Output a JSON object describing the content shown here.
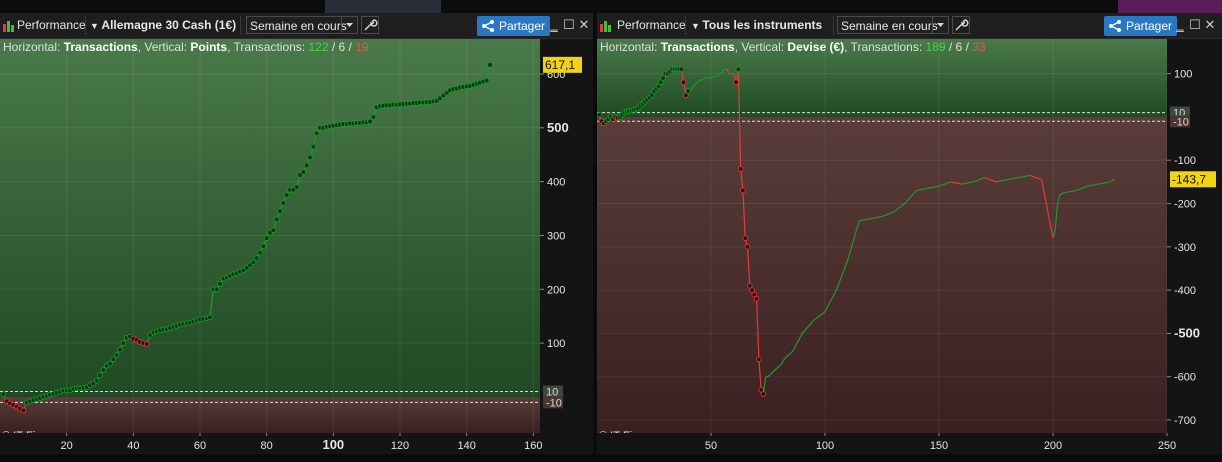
{
  "colors": {
    "profit_zone_top": "#4a7a4a",
    "profit_zone_bottom": "#1f4a24",
    "loss_zone_top": "#5a3d3a",
    "loss_zone_bottom": "#3a2020",
    "gain_line": "#1f9a2a",
    "loss_line": "#e53a3a",
    "share_button": "#2a78c4",
    "last_value_tag": "#f1d315",
    "positive_count": "#4bd14b",
    "negative_count": "#f05050"
  },
  "panels": [
    {
      "title_label": "Performance",
      "instrument": "Allemagne 30 Cash (1€)",
      "period": "Semaine en cours",
      "share_label": "Partager",
      "header": {
        "prefix": "Horizontal: ",
        "horizontal": "Transactions",
        "mid": ", Vertical: ",
        "vertical": "Points",
        "tx_label": ", Transactions: ",
        "tx_total": "122",
        "sep1": " / ",
        "tx_neutral": "6",
        "sep2": " / ",
        "tx_losses": "19"
      },
      "credit": "© IT-Finance.com",
      "last_value_tag": "617,1",
      "threshold_labels": [
        "10",
        "-10"
      ],
      "y_ticks": [
        "600",
        "500",
        "400",
        "300",
        "200",
        "100"
      ],
      "y_bold_tick": "500",
      "x_ticks": [
        "20",
        "40",
        "60",
        "80",
        "100",
        "120",
        "140",
        "160"
      ],
      "x_bold_tick": "100",
      "chart_data": {
        "type": "line",
        "xlabel": "",
        "ylabel": "",
        "xlim": [
          0,
          162
        ],
        "ylim": [
          -67,
          665
        ],
        "series": [
          {
            "x": [
              1,
              2,
              3,
              4,
              5,
              6,
              7,
              8,
              9,
              10,
              11,
              12,
              13,
              14,
              15,
              16,
              17,
              18,
              19,
              20,
              21,
              22,
              23,
              24,
              25,
              26,
              27,
              28,
              29,
              30,
              31,
              32,
              33,
              34,
              35,
              36,
              37,
              38,
              39,
              40,
              41,
              42,
              43,
              44,
              45,
              46,
              47,
              48,
              49,
              50,
              51,
              52,
              53,
              54,
              55,
              56,
              57,
              58,
              59,
              60,
              61,
              62,
              63,
              64,
              65,
              66,
              67,
              68,
              69,
              70,
              71,
              72,
              73,
              74,
              75,
              76,
              77,
              78,
              79,
              80,
              81,
              82,
              83,
              84,
              85,
              86,
              87,
              88,
              89,
              90,
              91,
              92,
              93,
              94,
              95,
              96,
              97,
              98,
              99,
              100,
              101,
              102,
              103,
              104,
              105,
              106,
              107,
              108,
              109,
              110,
              111,
              112,
              113,
              114,
              115,
              116,
              117,
              118,
              119,
              120,
              121,
              122,
              123,
              124,
              125,
              126,
              127,
              128,
              129,
              130,
              131,
              132,
              133,
              134,
              135,
              136,
              137,
              138,
              139,
              140,
              141,
              142,
              143,
              144,
              145,
              146,
              147
            ],
            "values": [
              5,
              -8,
              -12,
              -15,
              -18,
              -22,
              -25,
              -10,
              -8,
              -6,
              -4,
              -2,
              0,
              2,
              4,
              6,
              8,
              10,
              12,
              12,
              12,
              15,
              16,
              16,
              17,
              18,
              22,
              25,
              30,
              40,
              50,
              58,
              62,
              70,
              78,
              88,
              100,
              110,
              112,
              108,
              106,
              102,
              100,
              98,
              115,
              120,
              122,
              124,
              125,
              126,
              128,
              130,
              132,
              134,
              136,
              137,
              138,
              140,
              142,
              144,
              145,
              146,
              148,
              200,
              200,
              210,
              220,
              222,
              225,
              228,
              230,
              233,
              235,
              240,
              245,
              250,
              258,
              268,
              280,
              295,
              305,
              310,
              330,
              345,
              360,
              375,
              385,
              385,
              390,
              412,
              418,
              430,
              445,
              465,
              490,
              500,
              500,
              502,
              503,
              504,
              505,
              506,
              507,
              507,
              508,
              508,
              509,
              509,
              510,
              510,
              512,
              520,
              538,
              540,
              541,
              542,
              542,
              543,
              543,
              544,
              544,
              545,
              545,
              546,
              546,
              547,
              547,
              548,
              548,
              549,
              550,
              555,
              560,
              565,
              570,
              572,
              573,
              575,
              576,
              577,
              578,
              580,
              582,
              584,
              586,
              588,
              617
            ],
            "name": "",
            "y_units": "Points"
          }
        ]
      }
    },
    {
      "title_label": "Performance",
      "instrument": "Tous les instruments",
      "period": "Semaine en cours",
      "share_label": "Partager",
      "header": {
        "prefix": "Horizontal: ",
        "horizontal": "Transactions",
        "mid": ", Vertical: ",
        "vertical": "Devise (€)",
        "tx_label": ", Transactions: ",
        "tx_total": "189",
        "sep1": " / ",
        "tx_neutral": "6",
        "sep2": " / ",
        "tx_losses": "33"
      },
      "credit": "© IT-Finance.com",
      "last_value_tag": "-143,7",
      "threshold_labels": [
        "10",
        "-10"
      ],
      "y_ticks": [
        "100",
        "-100",
        "-200",
        "-300",
        "-400",
        "-500",
        "-600",
        "-700"
      ],
      "y_bold_tick": "-500",
      "x_ticks": [
        "50",
        "100",
        "150",
        "200",
        "250"
      ],
      "x_bold_tick": "",
      "chart_data": {
        "type": "line",
        "xlabel": "",
        "ylabel": "",
        "xlim": [
          0,
          250
        ],
        "ylim": [
          -730,
          180
        ],
        "series": [
          {
            "x": [
              1,
              2,
              3,
              4,
              5,
              6,
              7,
              8,
              9,
              10,
              11,
              12,
              13,
              14,
              15,
              16,
              17,
              18,
              19,
              20,
              21,
              22,
              23,
              24,
              25,
              26,
              27,
              28,
              29,
              30,
              31,
              32,
              33,
              34,
              35,
              36,
              37,
              38,
              39,
              40,
              41,
              42,
              43,
              44,
              45,
              46,
              47,
              48,
              49,
              50,
              51,
              52,
              53,
              54,
              55,
              56,
              57,
              58,
              59,
              60,
              61,
              62,
              63,
              64,
              65,
              66,
              67,
              68,
              69,
              70,
              71,
              72,
              73,
              74,
              75,
              76,
              77,
              78,
              79,
              80,
              81,
              82,
              83,
              84,
              85,
              86,
              87,
              88,
              89,
              90,
              95,
              100,
              105,
              110,
              115,
              120,
              125,
              130,
              135,
              140,
              145,
              150,
              155,
              160,
              165,
              170,
              175,
              180,
              185,
              190,
              195,
              200,
              201,
              202,
              203,
              205,
              210,
              215,
              220,
              225,
              227
            ],
            "values": [
              5,
              -10,
              -15,
              -10,
              -5,
              0,
              -5,
              0,
              -2,
              0,
              5,
              10,
              12,
              14,
              15,
              16,
              18,
              20,
              25,
              30,
              35,
              40,
              45,
              50,
              60,
              65,
              70,
              80,
              90,
              100,
              100,
              105,
              110,
              110,
              110,
              110,
              110,
              80,
              50,
              60,
              60,
              70,
              75,
              80,
              85,
              85,
              90,
              90,
              90,
              92,
              93,
              94,
              95,
              100,
              105,
              110,
              110,
              100,
              100,
              100,
              80,
              110,
              -120,
              -170,
              -280,
              -300,
              -390,
              -400,
              -410,
              -420,
              -560,
              -630,
              -640,
              -600,
              -600,
              -595,
              -590,
              -585,
              -580,
              -575,
              -570,
              -560,
              -555,
              -550,
              -545,
              -540,
              -530,
              -520,
              -510,
              -500,
              -470,
              -450,
              -400,
              -330,
              -240,
              -235,
              -230,
              -220,
              -200,
              -170,
              -165,
              -160,
              -150,
              -155,
              -150,
              -140,
              -150,
              -145,
              -140,
              -135,
              -145,
              -280,
              -260,
              -200,
              -180,
              -175,
              -170,
              -160,
              -155,
              -150,
              -144
            ],
            "name": "",
            "y_units": "Devise (€)"
          }
        ]
      }
    }
  ]
}
